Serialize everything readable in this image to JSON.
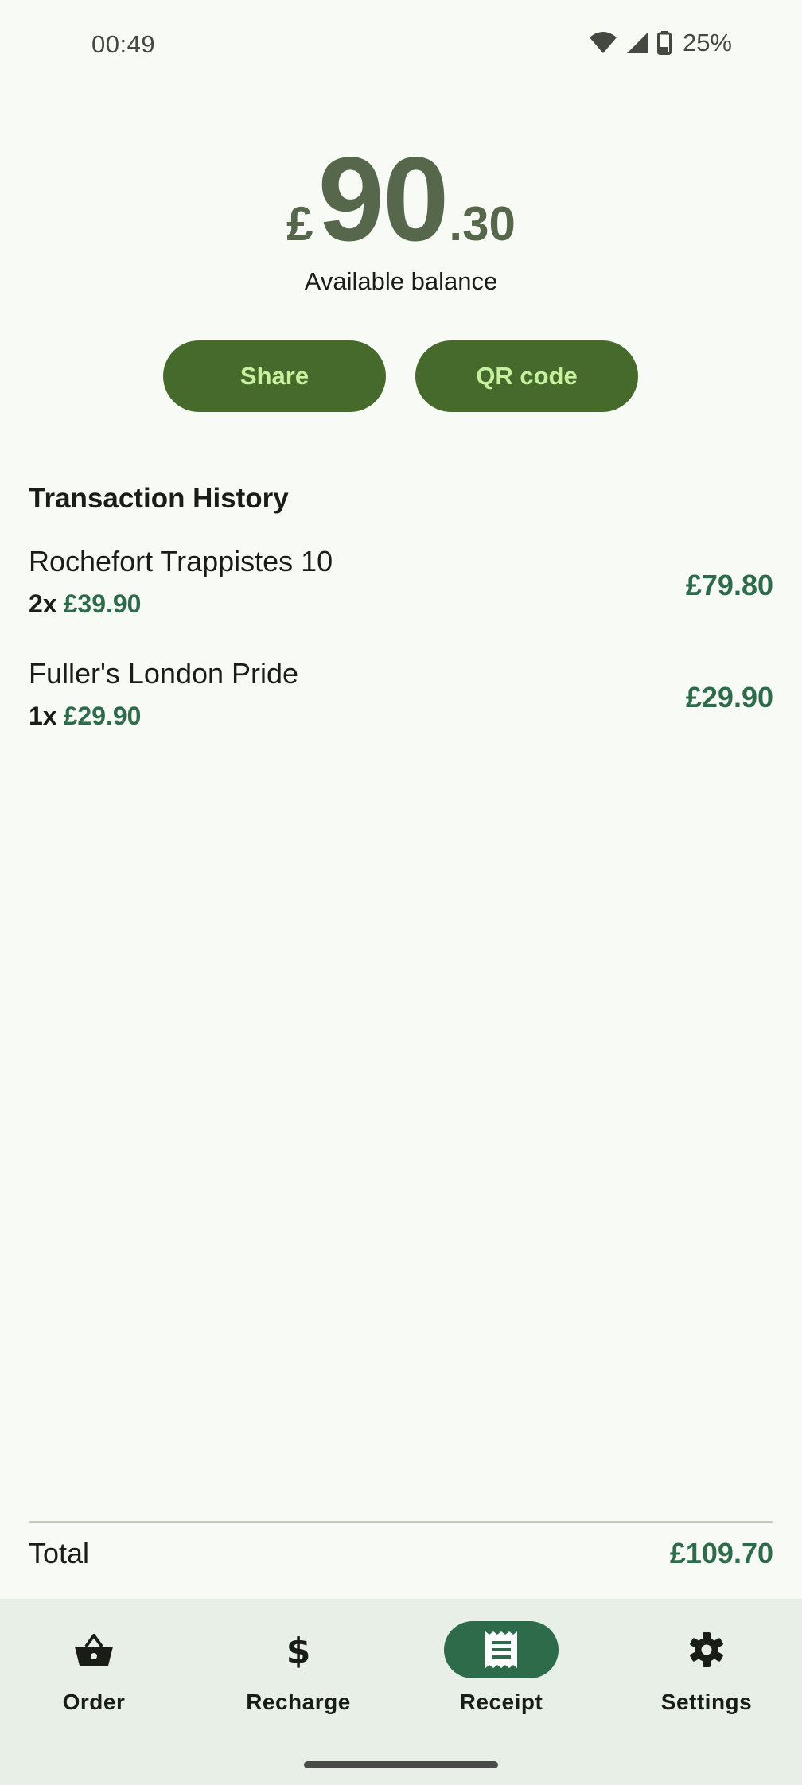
{
  "status": {
    "time": "00:49",
    "battery": "25%"
  },
  "balance": {
    "currency": "£",
    "whole": "90",
    "fraction": ".30",
    "label": "Available balance"
  },
  "actions": {
    "share_label": "Share",
    "qr_label": "QR code"
  },
  "history": {
    "title": "Transaction History",
    "items": [
      {
        "name": "Rochefort Trappistes 10",
        "qty": "2x",
        "unit_price": "£39.90",
        "total": "£79.80"
      },
      {
        "name": "Fuller's London Pride",
        "qty": "1x",
        "unit_price": "£29.90",
        "total": "£29.90"
      }
    ]
  },
  "summary": {
    "total_label": "Total",
    "total_value": "£109.70"
  },
  "nav": {
    "items": [
      {
        "label": "Order",
        "icon": "basket-icon"
      },
      {
        "label": "Recharge",
        "icon": "dollar-icon"
      },
      {
        "label": "Receipt",
        "icon": "receipt-icon",
        "active": true
      },
      {
        "label": "Settings",
        "icon": "gear-icon"
      }
    ]
  },
  "colors": {
    "accent": "#2e6b4a",
    "button_bg": "#466a2b",
    "button_text": "#c6f2a0",
    "balance": "#56674c",
    "background": "#f8faf5",
    "navbar_bg": "#e7efe6"
  }
}
